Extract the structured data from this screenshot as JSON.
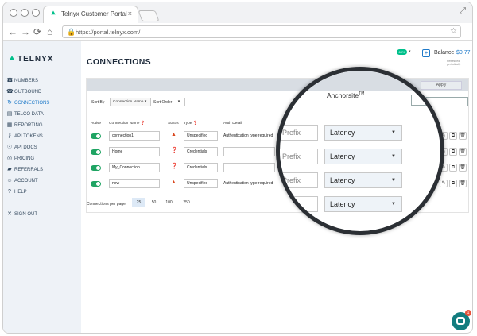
{
  "browser": {
    "tab_title": "Telnyx Customer Portal",
    "tab_close": "×",
    "url": "https://portal.telnyx.com/",
    "nav_back": "←",
    "nav_forward": "→",
    "nav_reload": "⟳",
    "nav_home": "⌂",
    "lock_glyph": "🔒",
    "star_glyph": "☆",
    "menu_glyph": "⋮",
    "expand_glyph": "⤢"
  },
  "brand": {
    "name": "TELNYX",
    "mark": "⯅"
  },
  "sidebar": {
    "items": [
      {
        "label": "NUMBERS",
        "icon": "☎"
      },
      {
        "label": "OUTBOUND",
        "icon": "☎"
      },
      {
        "label": "CONNECTIONS",
        "icon": "↻"
      },
      {
        "label": "TELCO DATA",
        "icon": "▤"
      },
      {
        "label": "REPORTING",
        "icon": "▦"
      },
      {
        "label": "API TOKENS",
        "icon": "⚷"
      },
      {
        "label": "API DOCS",
        "icon": "☉"
      },
      {
        "label": "PRICING",
        "icon": "◎"
      },
      {
        "label": "REFERRALS",
        "icon": "▰"
      },
      {
        "label": "ACCOUNT",
        "icon": "☺"
      },
      {
        "label": "HELP",
        "icon": "?"
      }
    ],
    "signout": {
      "label": "SIGN OUT",
      "icon": "✕"
    }
  },
  "header": {
    "title": "CONNECTIONS",
    "pill": "60%",
    "pill_caret": "▾",
    "plus": "+",
    "balance_label": "Balance",
    "balance_value": "$0.77",
    "balance_note": "Refreshed periodically"
  },
  "toolbar": {
    "apply": "Apply",
    "sort_by_label": "Sort By",
    "sort_by_value": "Connection Name ▾",
    "sort_order_label": "Sort Order",
    "sort_order_value": "▾"
  },
  "table": {
    "headers": {
      "active": "Active",
      "name": "Connection Name ❓",
      "status": "Status",
      "type": "Type ❓",
      "auth": "Auth Detail"
    },
    "rows": [
      {
        "name": "connection1",
        "status": "▲",
        "type": "Unspecified",
        "auth": "Authentication type required"
      },
      {
        "name": "Home",
        "status": "❓",
        "type": "Credentials",
        "auth": ""
      },
      {
        "name": "My_Connection",
        "status": "❓",
        "type": "Credentials",
        "auth": ""
      },
      {
        "name": "new",
        "status": "▲",
        "type": "Unspecified",
        "auth": "Authentication type required"
      }
    ],
    "row_actions": [
      "✎",
      "⧉",
      "🗑"
    ]
  },
  "pagination": {
    "label": "Connections per page:",
    "options": [
      "25",
      "50",
      "100",
      "250"
    ],
    "selected": "25"
  },
  "magnifier": {
    "header": "Anchorsite",
    "header_sup": "TM",
    "prefix_placeholder": "Prefix",
    "select_value": "Latency",
    "caret": "▼"
  },
  "chat": {
    "badge": "1"
  }
}
